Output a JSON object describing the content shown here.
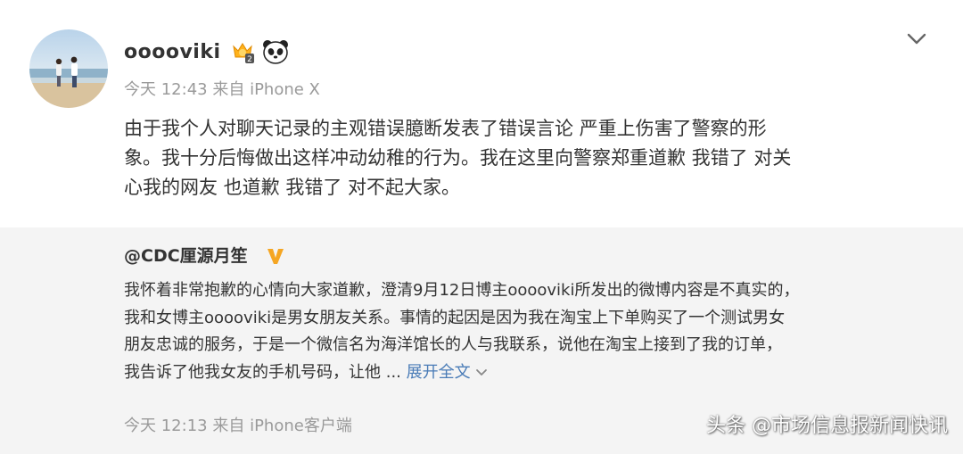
{
  "post": {
    "username": "ooooviki",
    "badge_icons": [
      "vip-level-icon",
      "panda-icon"
    ],
    "time": "今天 12:43",
    "source_prefix": "来自",
    "source": "iPhone X",
    "text_lines": [
      "由于我个人对聊天记录的主观错误臆断发表了错误言论 严重上伤害了警察的形",
      "象。我十分后悔做出这样冲动幼稚的行为。我在这里向警察郑重道歉 我错了 对关",
      "心我的网友 也道歉 我错了 对不起大家。"
    ]
  },
  "repost": {
    "author": "@CDC厘源月笙",
    "verified_icon": "verified-v-icon",
    "text_lines": [
      "我怀着非常抱歉的心情向大家道歉，澄清9月12日博主ooooviki所发出的微博内容是不真实的，",
      "我和女博主ooooviki是男女朋友关系。事情的起因是因为我在淘宝上下单购买了一个测试男女",
      "朋友忠诚的服务，于是一个微信名为海洋馆长的人与我联系，说他在淘宝上接到了我的订单，",
      "我告诉了他我女友的手机号码，让他 ..."
    ],
    "expand_label": "展开全文",
    "time": "今天 12:13",
    "source_prefix": "来自",
    "source": "iPhone客户端"
  },
  "watermark": "头条 @市场信息报新闻快讯",
  "colors": {
    "link": "#4a7cb7",
    "meta": "#9a9a9a",
    "repost_bg": "#f4f4f4",
    "verified": "#f5a623"
  }
}
